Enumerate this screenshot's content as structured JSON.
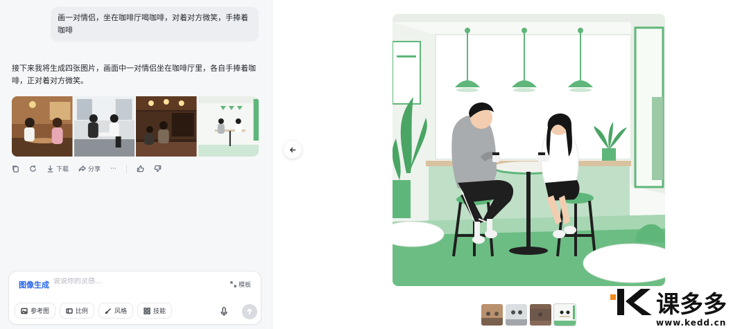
{
  "conversation": {
    "user_message": "画一对情侣，坐在咖啡厅喝咖啡，对着对方微笑，手捧着咖啡",
    "assistant_message": "接下来我将生成四张图片，画面中一对情侣坐在咖啡厅里，各自手捧着咖啡，正对着对方微笑。"
  },
  "actions": {
    "download_label": "下载",
    "share_label": "分享",
    "more_label": "···"
  },
  "composer": {
    "mode_label": "图像生成",
    "placeholder": "说说你的灵感...",
    "template_label": "模板",
    "chips": {
      "reference": "参考图",
      "ratio": "比例",
      "style": "风格",
      "skill": "技能"
    }
  },
  "watermark": {
    "brand": "课多多",
    "url": "www.kedd.cn"
  },
  "colors": {
    "accent": "#2563eb",
    "cafe_green": "#5fb67a",
    "watermark_orange": "#f28a1e"
  }
}
